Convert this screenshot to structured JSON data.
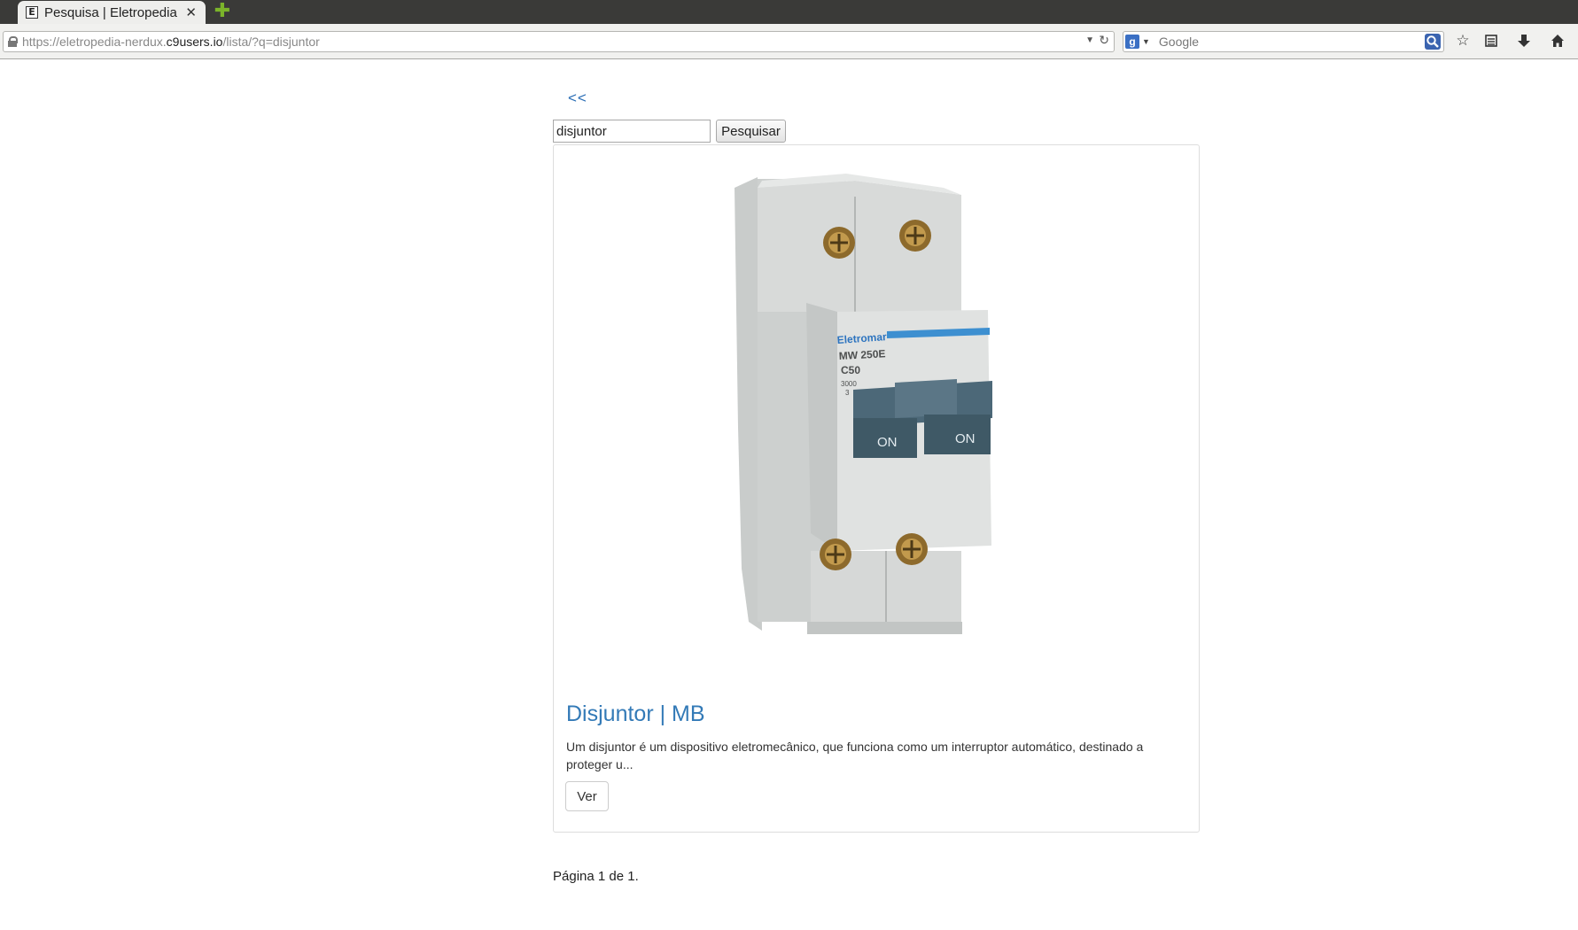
{
  "browser": {
    "tab_title": "Pesquisa | Eletropedia",
    "tab_favicon_letter": "E",
    "url_prefix": "https://eletropedia-nerdux.",
    "url_domain": "c9users.io",
    "url_path": "/lista/?q=disjuntor",
    "search_placeholder": "Google",
    "search_engine_letter": "g",
    "icons": [
      "lock-icon",
      "reload-icon",
      "google-icon",
      "search-icon",
      "bookmark-star-icon",
      "reading-list-icon",
      "download-icon",
      "home-icon",
      "close-icon",
      "new-tab-icon"
    ]
  },
  "page": {
    "back_link": "<<",
    "search": {
      "value": "disjuntor",
      "button_label": "Pesquisar"
    },
    "results": [
      {
        "title": "Disjuntor | MB",
        "description": "Um disjuntor é um dispositivo eletromecânico, que funciona como um interruptor automático, destinado a proteger u...",
        "button_label": "Ver",
        "image": {
          "brand": "Eletromar",
          "model": "MW 250E",
          "rating": "C50",
          "capacity": "3000",
          "class": "3",
          "switch_label": "ON"
        }
      }
    ],
    "pagination": "Página 1 de 1."
  },
  "colors": {
    "link": "#337ab7",
    "chrome_dark": "#3a3a38",
    "breaker_lever": "#4c6878",
    "breaker_body": "#d7d9d8"
  }
}
